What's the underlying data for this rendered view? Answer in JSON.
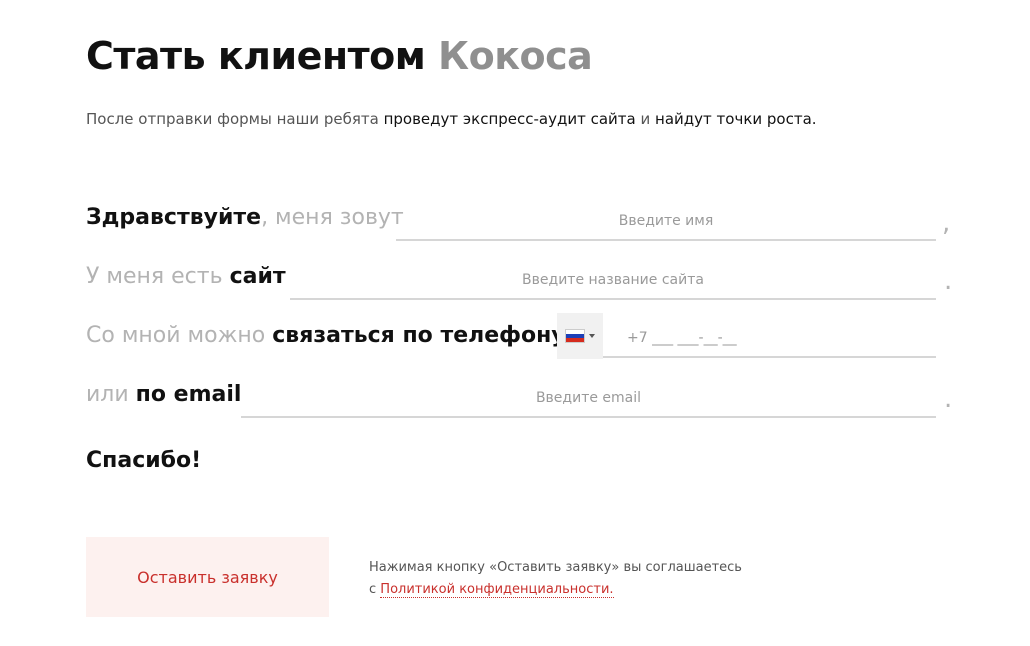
{
  "header": {
    "title_main": "Стать клиентом",
    "title_highlight": "Кокоса"
  },
  "intro": {
    "part1": "После отправки формы наши ребята",
    "part2": "проведут экспресс-аудит сайта",
    "part3": "и",
    "part4": "найдут точки роста."
  },
  "form": {
    "row_name": {
      "label_bold": "Здравствуйте",
      "label_light": ", меня зовут",
      "placeholder": "Введите имя",
      "end_punct": ","
    },
    "row_site": {
      "label_light": "У меня есть",
      "label_bold": "сайт",
      "placeholder": "Введите название сайта",
      "end_punct": "."
    },
    "row_phone": {
      "label_light": "Со мной можно",
      "label_bold": "связаться по телефону",
      "country": "russia-flag-icon",
      "placeholder": "+7 ___ ___-__-__"
    },
    "row_email": {
      "label_light": "или",
      "label_bold": "по email",
      "placeholder": "Введите email",
      "end_punct": "."
    },
    "thanks": "Спасибо!"
  },
  "submit": {
    "label": "Оставить заявку"
  },
  "consent": {
    "line1": "Нажимая кнопку «Оставить заявку» вы соглашаетесь",
    "line2_prefix": "с",
    "link": "Политикой конфиденциальности."
  },
  "colors": {
    "accent": "#c9302c",
    "button_bg": "#fdf1ef",
    "muted": "#b3b3b3"
  }
}
